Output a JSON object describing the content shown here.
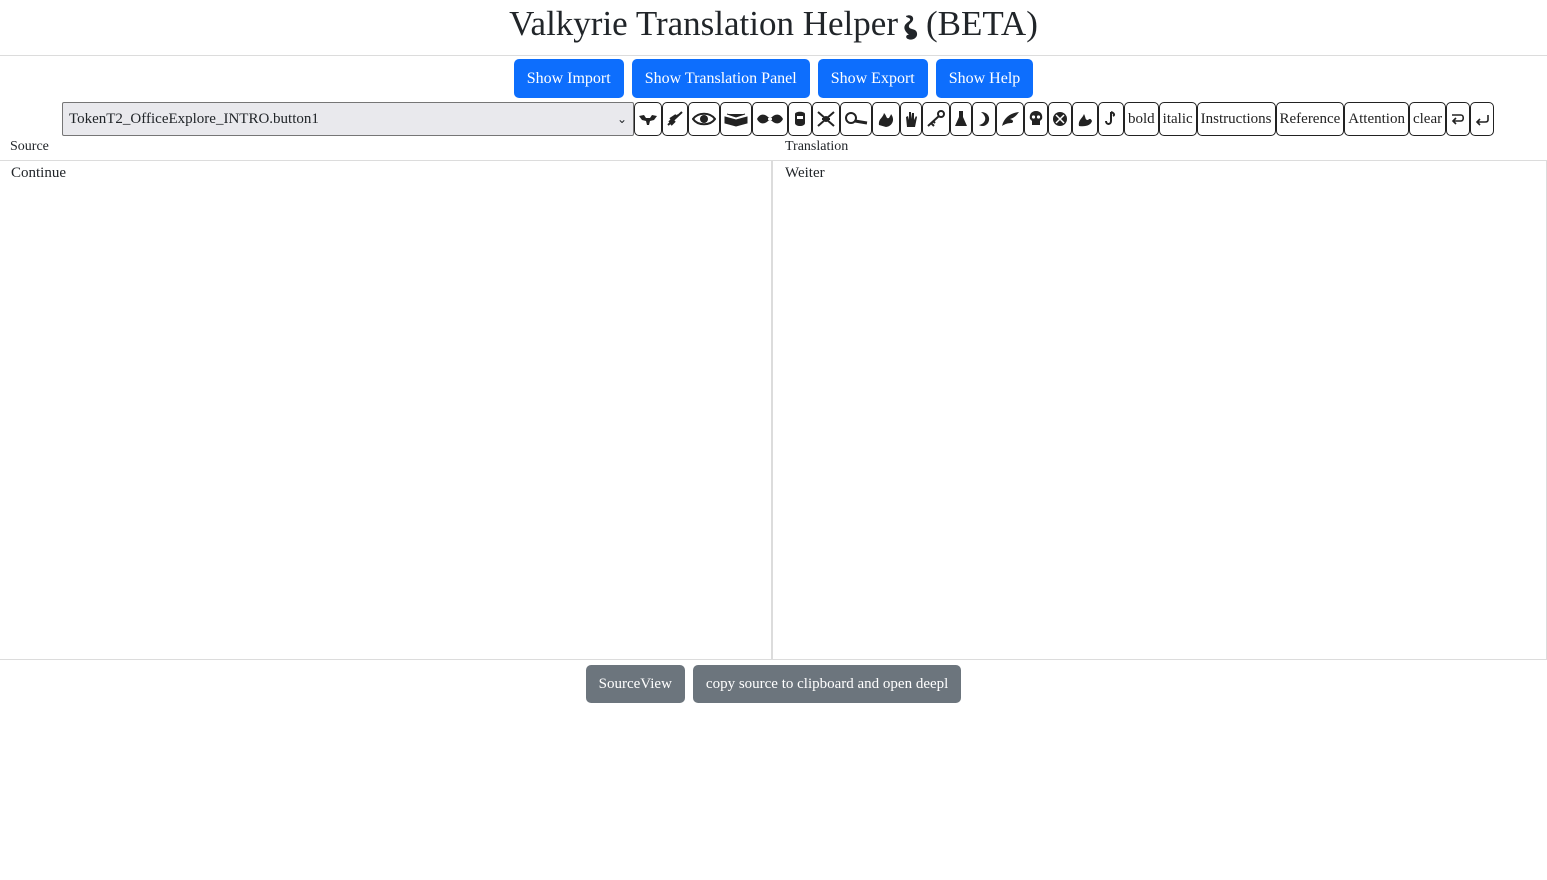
{
  "app": {
    "title": "Valkyrie Translation Helper",
    "title_suffix": "(BETA)"
  },
  "top_buttons": {
    "import": "Show Import",
    "translation_panel": "Show Translation Panel",
    "export": "Show Export",
    "help": "Show Help"
  },
  "toolbar": {
    "key_select_value": "TokenT2_OfficeExplore_INTRO.button1",
    "symbol_icons": [
      "strength-icon",
      "agility-icon",
      "observation-icon",
      "lore-icon",
      "influence-icon",
      "will-icon",
      "combat-icon",
      "research-icon",
      "fire-icon",
      "hand-icon",
      "key-icon",
      "chemistry-icon",
      "moon-icon",
      "wing-icon",
      "skull-icon",
      "elder-sign-icon",
      "tentacle-icon",
      "hook-icon"
    ],
    "bold": "bold",
    "italic": "italic",
    "instructions": "Instructions",
    "reference": "Reference",
    "attention": "Attention",
    "clear": "clear",
    "redo_icon": "redo-icon",
    "undo_icon": "undo-icon"
  },
  "labels": {
    "source": "Source",
    "translation": "Translation"
  },
  "content": {
    "source_text": "Continue",
    "translation_text": "Weiter"
  },
  "bottom_buttons": {
    "source_view": "SourceView",
    "deepl": "copy source to clipboard and open deepl"
  }
}
